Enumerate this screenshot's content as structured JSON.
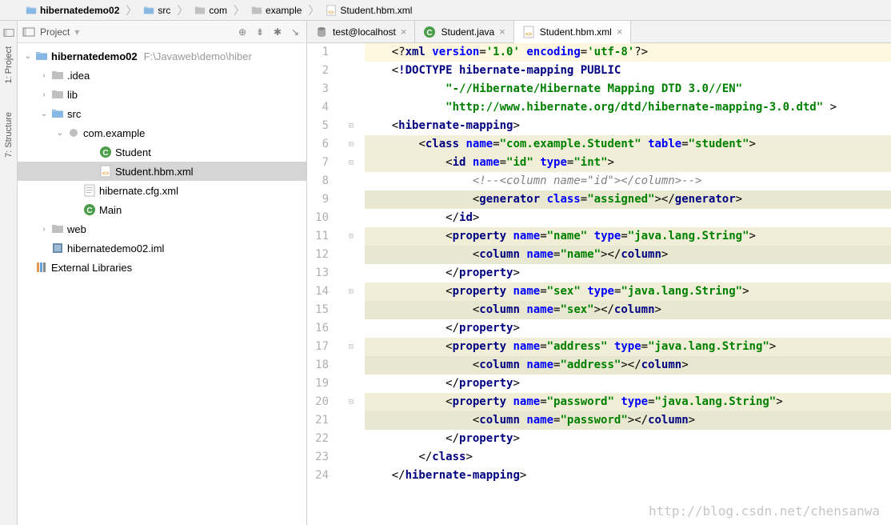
{
  "breadcrumb": [
    {
      "icon": "folder-blue",
      "label": "hibernatedemo02",
      "bold": true
    },
    {
      "icon": "folder-blue",
      "label": "src"
    },
    {
      "icon": "folder-gray",
      "label": "com"
    },
    {
      "icon": "folder-gray",
      "label": "example"
    },
    {
      "icon": "xml",
      "label": "Student.hbm.xml"
    }
  ],
  "rail": {
    "project": "1: Project",
    "structure": "7: Structure"
  },
  "project": {
    "title": "Project",
    "tree": [
      {
        "indent": 8,
        "arrow": "down",
        "icon": "folder-blue",
        "label": "hibernatedemo02",
        "bold": true,
        "suffix": "F:\\Javaweb\\demo\\hiber"
      },
      {
        "indent": 28,
        "arrow": "right",
        "icon": "folder-gray",
        "label": ".idea"
      },
      {
        "indent": 28,
        "arrow": "right",
        "icon": "folder-gray",
        "label": "lib"
      },
      {
        "indent": 28,
        "arrow": "down",
        "icon": "folder-blue",
        "label": "src"
      },
      {
        "indent": 48,
        "arrow": "down",
        "icon": "package",
        "label": "com.example"
      },
      {
        "indent": 88,
        "arrow": "",
        "icon": "class",
        "label": "Student"
      },
      {
        "indent": 88,
        "arrow": "",
        "icon": "xml",
        "label": "Student.hbm.xml",
        "selected": true
      },
      {
        "indent": 68,
        "arrow": "",
        "icon": "xml-file",
        "label": "hibernate.cfg.xml"
      },
      {
        "indent": 68,
        "arrow": "",
        "icon": "class",
        "label": "Main"
      },
      {
        "indent": 28,
        "arrow": "right",
        "icon": "folder-gray",
        "label": "web"
      },
      {
        "indent": 28,
        "arrow": "",
        "icon": "iml",
        "label": "hibernatedemo02.iml"
      },
      {
        "indent": 8,
        "arrow": "",
        "icon": "lib",
        "label": "External Libraries"
      }
    ]
  },
  "tabs": [
    {
      "icon": "db",
      "label": "test@localhost",
      "active": false
    },
    {
      "icon": "class",
      "label": "Student.java",
      "active": false
    },
    {
      "icon": "xml",
      "label": "Student.hbm.xml",
      "active": true
    }
  ],
  "code": {
    "lines": [
      {
        "n": 1,
        "t": "xml_decl",
        "raw": "<?xml version='1.0' encoding='utf-8'?>",
        "hl": "line-hl"
      },
      {
        "n": 2,
        "t": "doctype1"
      },
      {
        "n": 3,
        "t": "doctype2"
      },
      {
        "n": 4,
        "t": "doctype3"
      },
      {
        "n": 5,
        "t": "hm_open"
      },
      {
        "n": 6,
        "t": "class_open",
        "hl": "bg-warn"
      },
      {
        "n": 7,
        "t": "id_open",
        "hl": "bg-warn"
      },
      {
        "n": 8,
        "t": "id_comment"
      },
      {
        "n": 9,
        "t": "generator",
        "hl": "bg-hint"
      },
      {
        "n": 10,
        "t": "id_close"
      },
      {
        "n": 11,
        "t": "prop_name",
        "hl": "bg-warn"
      },
      {
        "n": 12,
        "t": "col_name",
        "hl": "bg-hint"
      },
      {
        "n": 13,
        "t": "prop_close"
      },
      {
        "n": 14,
        "t": "prop_sex",
        "hl": "bg-warn"
      },
      {
        "n": 15,
        "t": "col_sex",
        "hl": "bg-hint"
      },
      {
        "n": 16,
        "t": "prop_close"
      },
      {
        "n": 17,
        "t": "prop_address",
        "hl": "bg-warn"
      },
      {
        "n": 18,
        "t": "col_address",
        "hl": "bg-hint"
      },
      {
        "n": 19,
        "t": "prop_close"
      },
      {
        "n": 20,
        "t": "prop_password",
        "hl": "bg-warn"
      },
      {
        "n": 21,
        "t": "col_password",
        "hl": "bg-hint"
      },
      {
        "n": 22,
        "t": "prop_close"
      },
      {
        "n": 23,
        "t": "class_close"
      },
      {
        "n": 24,
        "t": "hm_close"
      }
    ],
    "tokens": {
      "xml_decl": "<?xml version='1.0' encoding='utf-8'?>",
      "doctype_kw": "!DOCTYPE",
      "doctype_rest": "hibernate-mapping PUBLIC",
      "dtd1": "\"-//Hibernate/Hibernate Mapping DTD 3.0//EN\"",
      "dtd2": "\"http://www.hibernate.org/dtd/hibernate-mapping-3.0.dtd\"",
      "tag_hm": "hibernate-mapping",
      "tag_class": "class",
      "attr_name": "name",
      "attr_table": "table",
      "class_name": "\"com.example.Student\"",
      "table_name": "\"student\"",
      "tag_id": "id",
      "attr_type": "type",
      "id_name": "\"id\"",
      "id_type": "\"int\"",
      "id_comment": "<!--<column name=\"id\"></column>-->",
      "tag_gen": "generator",
      "attr_class": "class",
      "gen_class": "\"assigned\"",
      "tag_prop": "property",
      "tag_col": "column",
      "p_name": "\"name\"",
      "t_string": "\"java.lang.String\"",
      "c_name": "\"name\"",
      "p_sex": "\"sex\"",
      "c_sex": "\"sex\"",
      "p_address": "\"address\"",
      "c_address": "\"address\"",
      "p_password": "\"password\"",
      "c_password": "\"password\""
    }
  },
  "watermark": "http://blog.csdn.net/chensanwa"
}
